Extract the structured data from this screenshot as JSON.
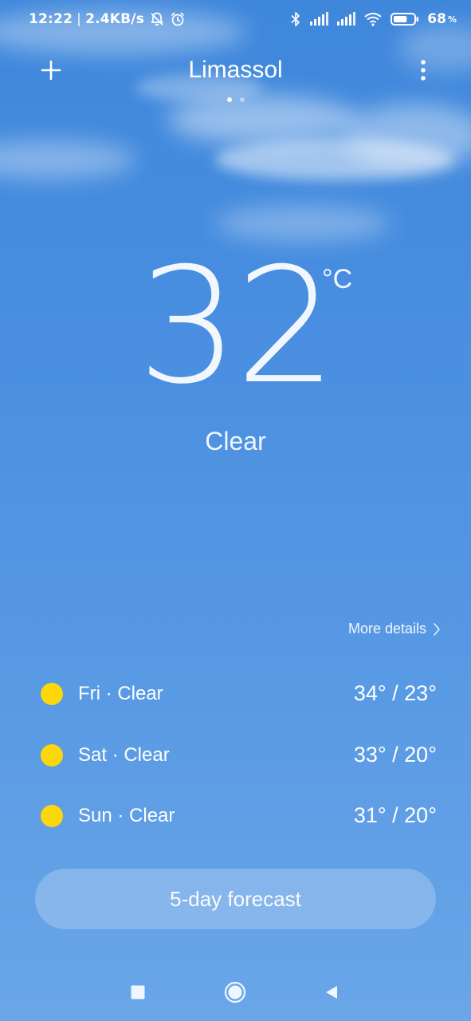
{
  "status_bar": {
    "time": "12:22",
    "separator": "|",
    "network_speed": "2.4KB/s",
    "battery_percent": "68",
    "battery_unit": "%",
    "battery_level": 0.68,
    "icons": [
      "bell-off-icon",
      "alarm-icon",
      "bluetooth-icon",
      "signal-icon",
      "signal-icon",
      "wifi-icon",
      "battery-icon"
    ]
  },
  "header": {
    "city": "Limassol",
    "add_icon": "plus-icon",
    "menu_icon": "more-vertical-icon",
    "pages": 2,
    "active_page": 1
  },
  "current": {
    "temperature": "32",
    "unit": "°C",
    "condition": "Clear"
  },
  "more_details": {
    "label": "More details",
    "icon": "chevron-right-icon"
  },
  "forecast": [
    {
      "day_label": "Fri · Clear",
      "range": "34° / 23°",
      "icon": "sun-icon"
    },
    {
      "day_label": "Sat · Clear",
      "range": "33° / 20°",
      "icon": "sun-icon"
    },
    {
      "day_label": "Sun · Clear",
      "range": "31° / 20°",
      "icon": "sun-icon"
    }
  ],
  "forecast_button": {
    "label": "5-day forecast"
  },
  "nav_bar": {
    "icons": [
      "recents-square-icon",
      "home-circle-icon",
      "back-triangle-icon"
    ]
  },
  "colors": {
    "sky_top": "#3f87db",
    "sky_bottom": "#6aa6e8",
    "sun": "#fcd80a",
    "text": "#ffffff"
  }
}
